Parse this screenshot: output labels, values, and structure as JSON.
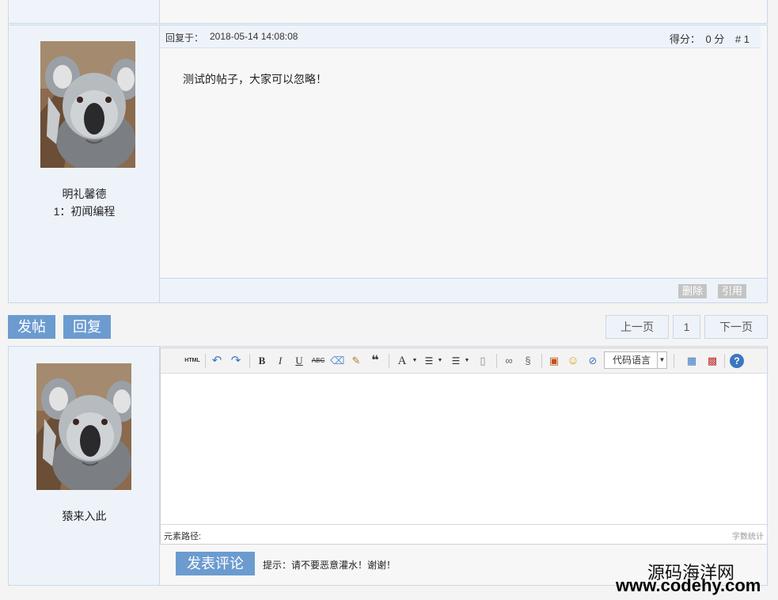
{
  "post": {
    "reply_label": "回复于：",
    "reply_time": "2018-05-14 14:08:08",
    "score_label": "得分：",
    "score_value": "0 分",
    "floor": "# 1",
    "content": "测试的帖子，大家可以忽略！",
    "author": {
      "name": "明礼馨德",
      "level": "1：初闻编程"
    },
    "delete_label": "删除",
    "quote_label": "引用"
  },
  "actions": {
    "new_post_label": "发帖",
    "reply_label": "回复"
  },
  "pager": {
    "prev_label": "上一页",
    "current_page": "1",
    "next_label": "下一页"
  },
  "reply_form": {
    "author_name": "猿来入此",
    "toolbar": {
      "html_label": "HTML",
      "code_language_label": "代码语言"
    },
    "path_label": "元素路径:",
    "word_count_label": "字数统计",
    "submit_label": "发表评论",
    "hint": "提示：请不要恶意灌水！谢谢！"
  },
  "watermark": {
    "line1": "源码海洋网",
    "line2": "www.codehy.com"
  },
  "colors": {
    "accent_blue": "#6c9bd0",
    "panel_bg": "#eef3fa",
    "border": "#c9d8e8"
  }
}
